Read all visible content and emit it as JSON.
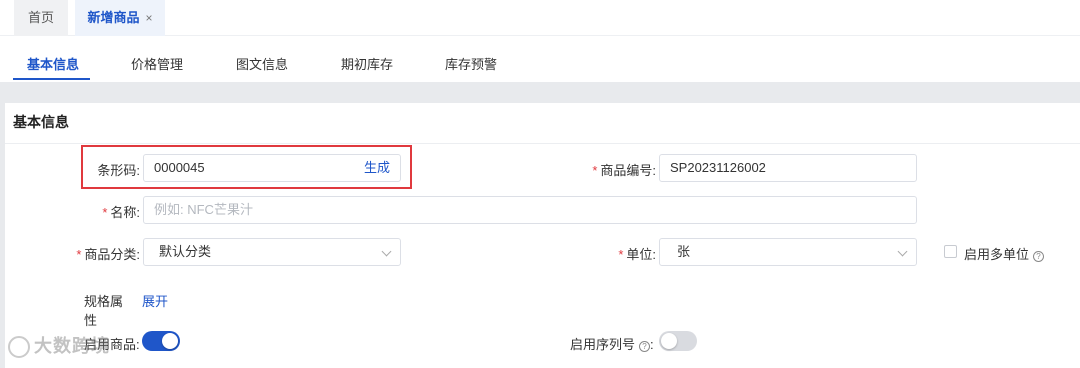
{
  "page_tabs": {
    "home": "首页",
    "active": "新增商品",
    "close_glyph": "×"
  },
  "sub_tabs": [
    "基本信息",
    "价格管理",
    "图文信息",
    "期初库存",
    "库存预警"
  ],
  "section": {
    "title": "基本信息"
  },
  "form": {
    "barcode": {
      "label": "条形码:",
      "value": "0000045",
      "action": "生成"
    },
    "product_code": {
      "required": "*",
      "label": "商品编号:",
      "value": "SP20231126002"
    },
    "name": {
      "required": "*",
      "label": "名称:",
      "placeholder": "例如: NFC芒果汁"
    },
    "category": {
      "required": "*",
      "label": "商品分类:",
      "value": "默认分类"
    },
    "unit": {
      "required": "*",
      "label": "单位:",
      "value": "张"
    },
    "multi_unit": {
      "label": "启用多单位",
      "checked": false
    },
    "spec": {
      "label": "规格属性",
      "action": "展开"
    },
    "enable_product": {
      "label": "启用商品:",
      "on": true
    },
    "enable_serial": {
      "label": "启用序列号",
      "suffix": ":",
      "on": false
    }
  },
  "help_glyph": "?",
  "watermark": "大数跨境",
  "colors": {
    "primary": "#1f56c9",
    "required": "#e0393e",
    "highlight_box": "#e0393e"
  }
}
